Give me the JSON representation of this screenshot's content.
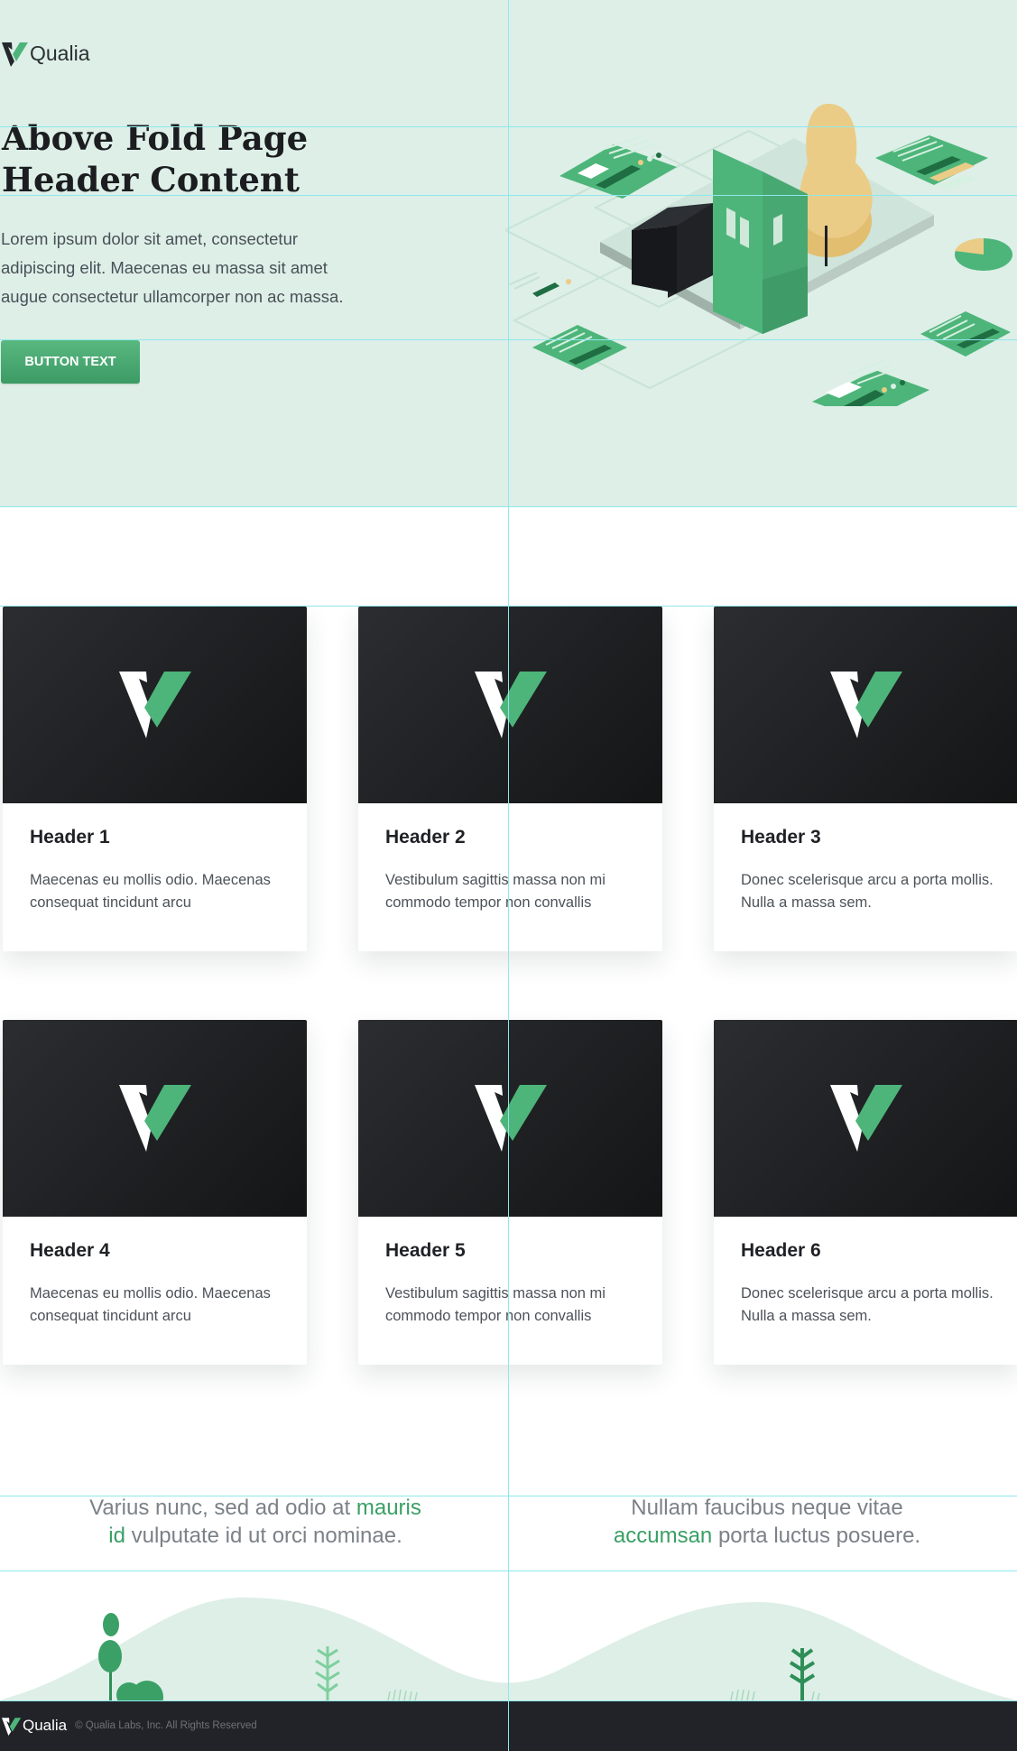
{
  "brand": {
    "name": "Qualia"
  },
  "hero": {
    "title_line1": "Above Fold Page",
    "title_line2": "Header Content",
    "description": "Lorem ipsum dolor sit amet, consectetur adipiscing elit. Maecenas eu massa sit amet augue consectetur ullamcorper non ac massa.",
    "button_label": "BUTTON TEXT"
  },
  "cards": [
    {
      "title": "Header 1",
      "text": "Maecenas eu mollis odio. Maecenas consequat tincidunt arcu"
    },
    {
      "title": "Header 2",
      "text": "Vestibulum sagittis massa non mi commodo tempor non convallis"
    },
    {
      "title": "Header 3",
      "text": "Donec scelerisque arcu a porta mollis. Nulla a massa sem."
    },
    {
      "title": "Header 4",
      "text": "Maecenas eu mollis odio. Maecenas consequat tincidunt arcu"
    },
    {
      "title": "Header 5",
      "text": "Vestibulum sagittis massa non mi commodo tempor non convallis"
    },
    {
      "title": "Header 6",
      "text": "Donec scelerisque arcu a porta mollis. Nulla a massa sem."
    }
  ],
  "quotes": [
    {
      "before": "Varius nunc, sed ad odio at ",
      "highlight": "mauris id",
      "after": " vulputate id ut orci nominae."
    },
    {
      "before": "Nullam faucibus neque vitae ",
      "highlight": "accumsan",
      "after": " porta luctus posuere."
    }
  ],
  "footer": {
    "brand": "Qualia",
    "copyright": "© Qualia Labs, Inc. All Rights Reserved"
  },
  "colors": {
    "hero_background": "#ddefe7",
    "accent_green": "#4db57a",
    "highlight_green": "#3a9f65",
    "card_media_dark": "#1b1c1f",
    "footer_background": "#212328",
    "guide_lines": "#8fe8ec"
  },
  "icons": [
    "qualia-logo-icon",
    "card-logo-icon"
  ]
}
